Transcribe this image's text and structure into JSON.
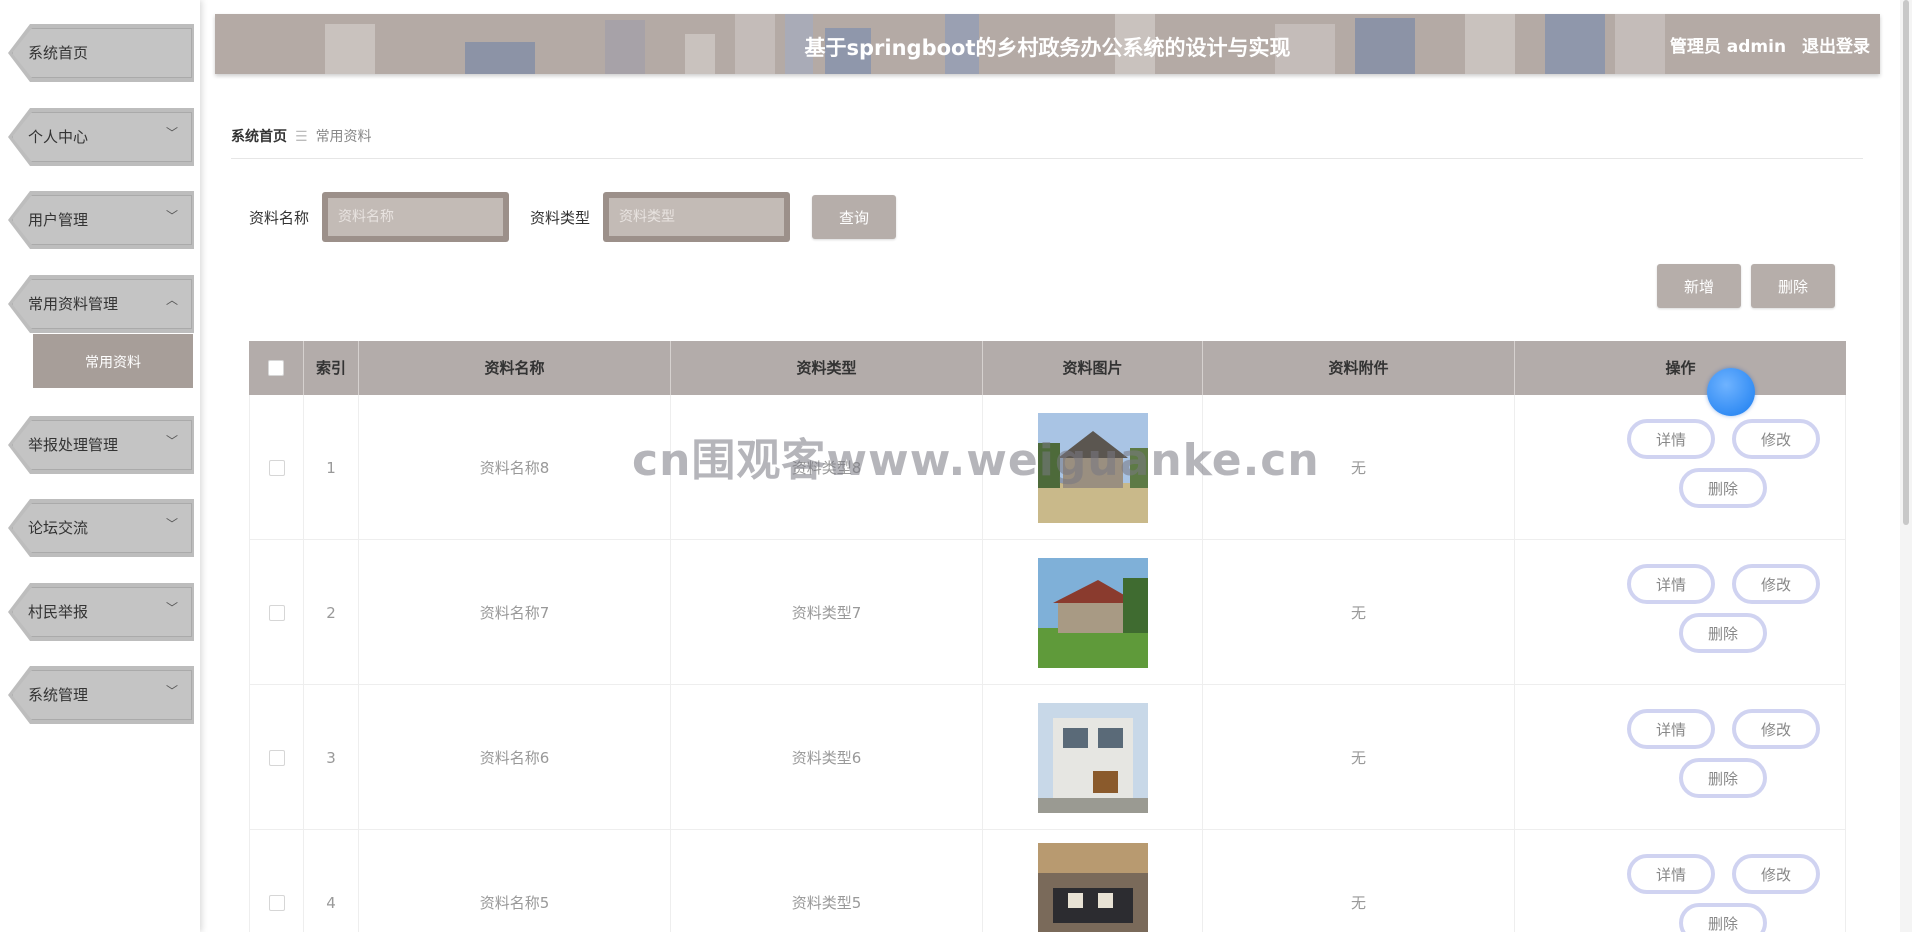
{
  "header": {
    "title": "基于springboot的乡村政务办公系统的设计与实现",
    "user": "管理员 admin",
    "logout": "退出登录"
  },
  "sidebar": {
    "items": [
      {
        "label": "系统首页",
        "has_children": false
      },
      {
        "label": "个人中心",
        "has_children": true
      },
      {
        "label": "用户管理",
        "has_children": true
      },
      {
        "label": "常用资料管理",
        "has_children": true,
        "expanded": true
      },
      {
        "label": "举报处理管理",
        "has_children": true
      },
      {
        "label": "论坛交流",
        "has_children": true
      },
      {
        "label": "村民举报",
        "has_children": true
      },
      {
        "label": "系统管理",
        "has_children": true
      }
    ],
    "submenu": {
      "label": "常用资料"
    }
  },
  "breadcrumb": {
    "home": "系统首页",
    "current": "常用资料"
  },
  "search": {
    "name_label": "资料名称",
    "name_placeholder": "资料名称",
    "type_label": "资料类型",
    "type_placeholder": "资料类型",
    "query_button": "查询"
  },
  "actions": {
    "add": "新增",
    "delete": "删除"
  },
  "table": {
    "columns": [
      "索引",
      "资料名称",
      "资料类型",
      "资料图片",
      "资料附件",
      "操作"
    ],
    "rows": [
      {
        "index": "1",
        "name": "资料名称8",
        "type": "资料类型8",
        "attachment": "无"
      },
      {
        "index": "2",
        "name": "资料名称7",
        "type": "资料类型7",
        "attachment": "无"
      },
      {
        "index": "3",
        "name": "资料名称6",
        "type": "资料类型6",
        "attachment": "无"
      },
      {
        "index": "4",
        "name": "资料名称5",
        "type": "资料类型5",
        "attachment": "无"
      }
    ],
    "op_labels": {
      "detail": "详情",
      "edit": "修改",
      "delete": "删除"
    }
  },
  "watermark": "cn围观客www.weiguanke.cn"
}
